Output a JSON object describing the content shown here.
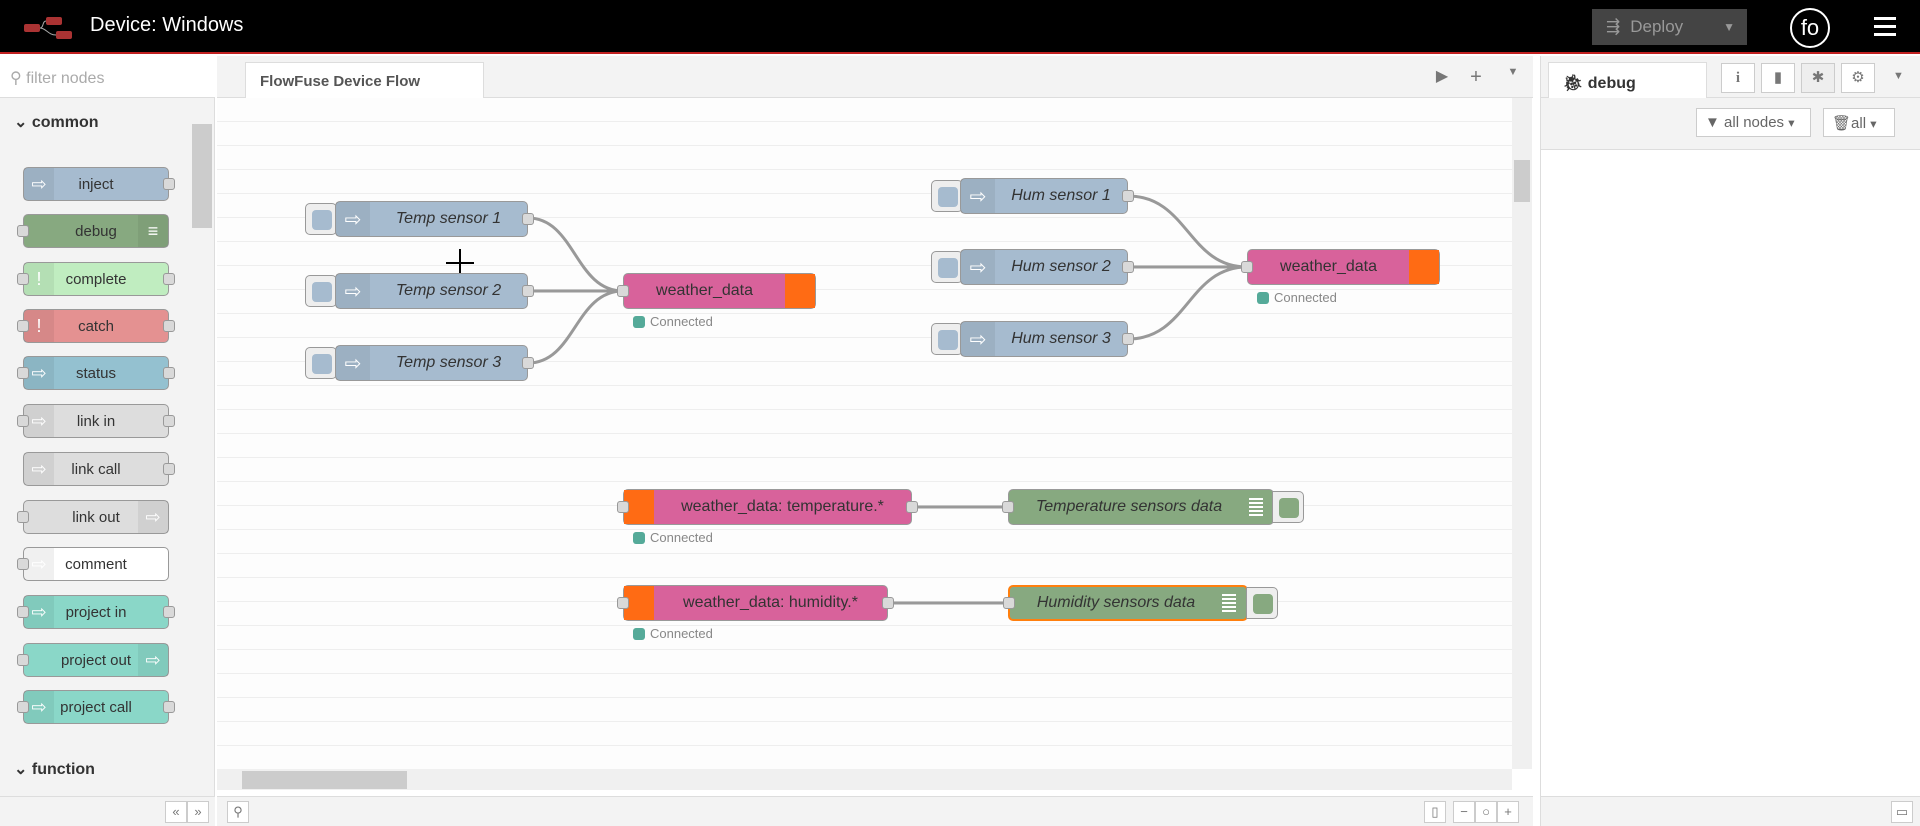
{
  "header": {
    "title": "Device: Windows",
    "deploy_label": "Deploy",
    "avatar_initials": "fo"
  },
  "palette": {
    "filter_placeholder": "filter nodes",
    "categories": [
      "common",
      "function"
    ],
    "nodes": [
      {
        "label": "inject",
        "color": "#a6bbcf"
      },
      {
        "label": "debug",
        "color": "#87a980"
      },
      {
        "label": "complete",
        "color": "#c0edc0"
      },
      {
        "label": "catch",
        "color": "#e49191"
      },
      {
        "label": "status",
        "color": "#94c1d0"
      },
      {
        "label": "link in",
        "color": "#dddddd"
      },
      {
        "label": "link call",
        "color": "#dddddd"
      },
      {
        "label": "link out",
        "color": "#dddddd"
      },
      {
        "label": "comment",
        "color": "#ffffff"
      },
      {
        "label": "project in",
        "color": "#8ad7c8"
      },
      {
        "label": "project out",
        "color": "#8ad7c8"
      },
      {
        "label": "project call",
        "color": "#8ad7c8"
      }
    ]
  },
  "workspace": {
    "tab": "FlowFuse Device Flow"
  },
  "flow": {
    "inject": [
      "Temp sensor 1",
      "Temp sensor 2",
      "Temp sensor 3",
      "Hum sensor 1",
      "Hum sensor 2",
      "Hum sensor 3"
    ],
    "mqtt": [
      "weather_data",
      "weather_data",
      "weather_data: temperature.*",
      "weather_data: humidity.*"
    ],
    "debug": [
      "Temperature sensors data",
      "Humidity sensors data"
    ],
    "status": "Connected"
  },
  "sidebar": {
    "tab": "debug",
    "filter": "all nodes",
    "clear": "all"
  },
  "colors": {
    "inject": "#a6bbcf",
    "mqtt": "#d8629b",
    "mqtt_icon": "#ff6b14",
    "debug": "#87a980",
    "selected": "#ff7f0e",
    "status_ok": "#5a9"
  }
}
